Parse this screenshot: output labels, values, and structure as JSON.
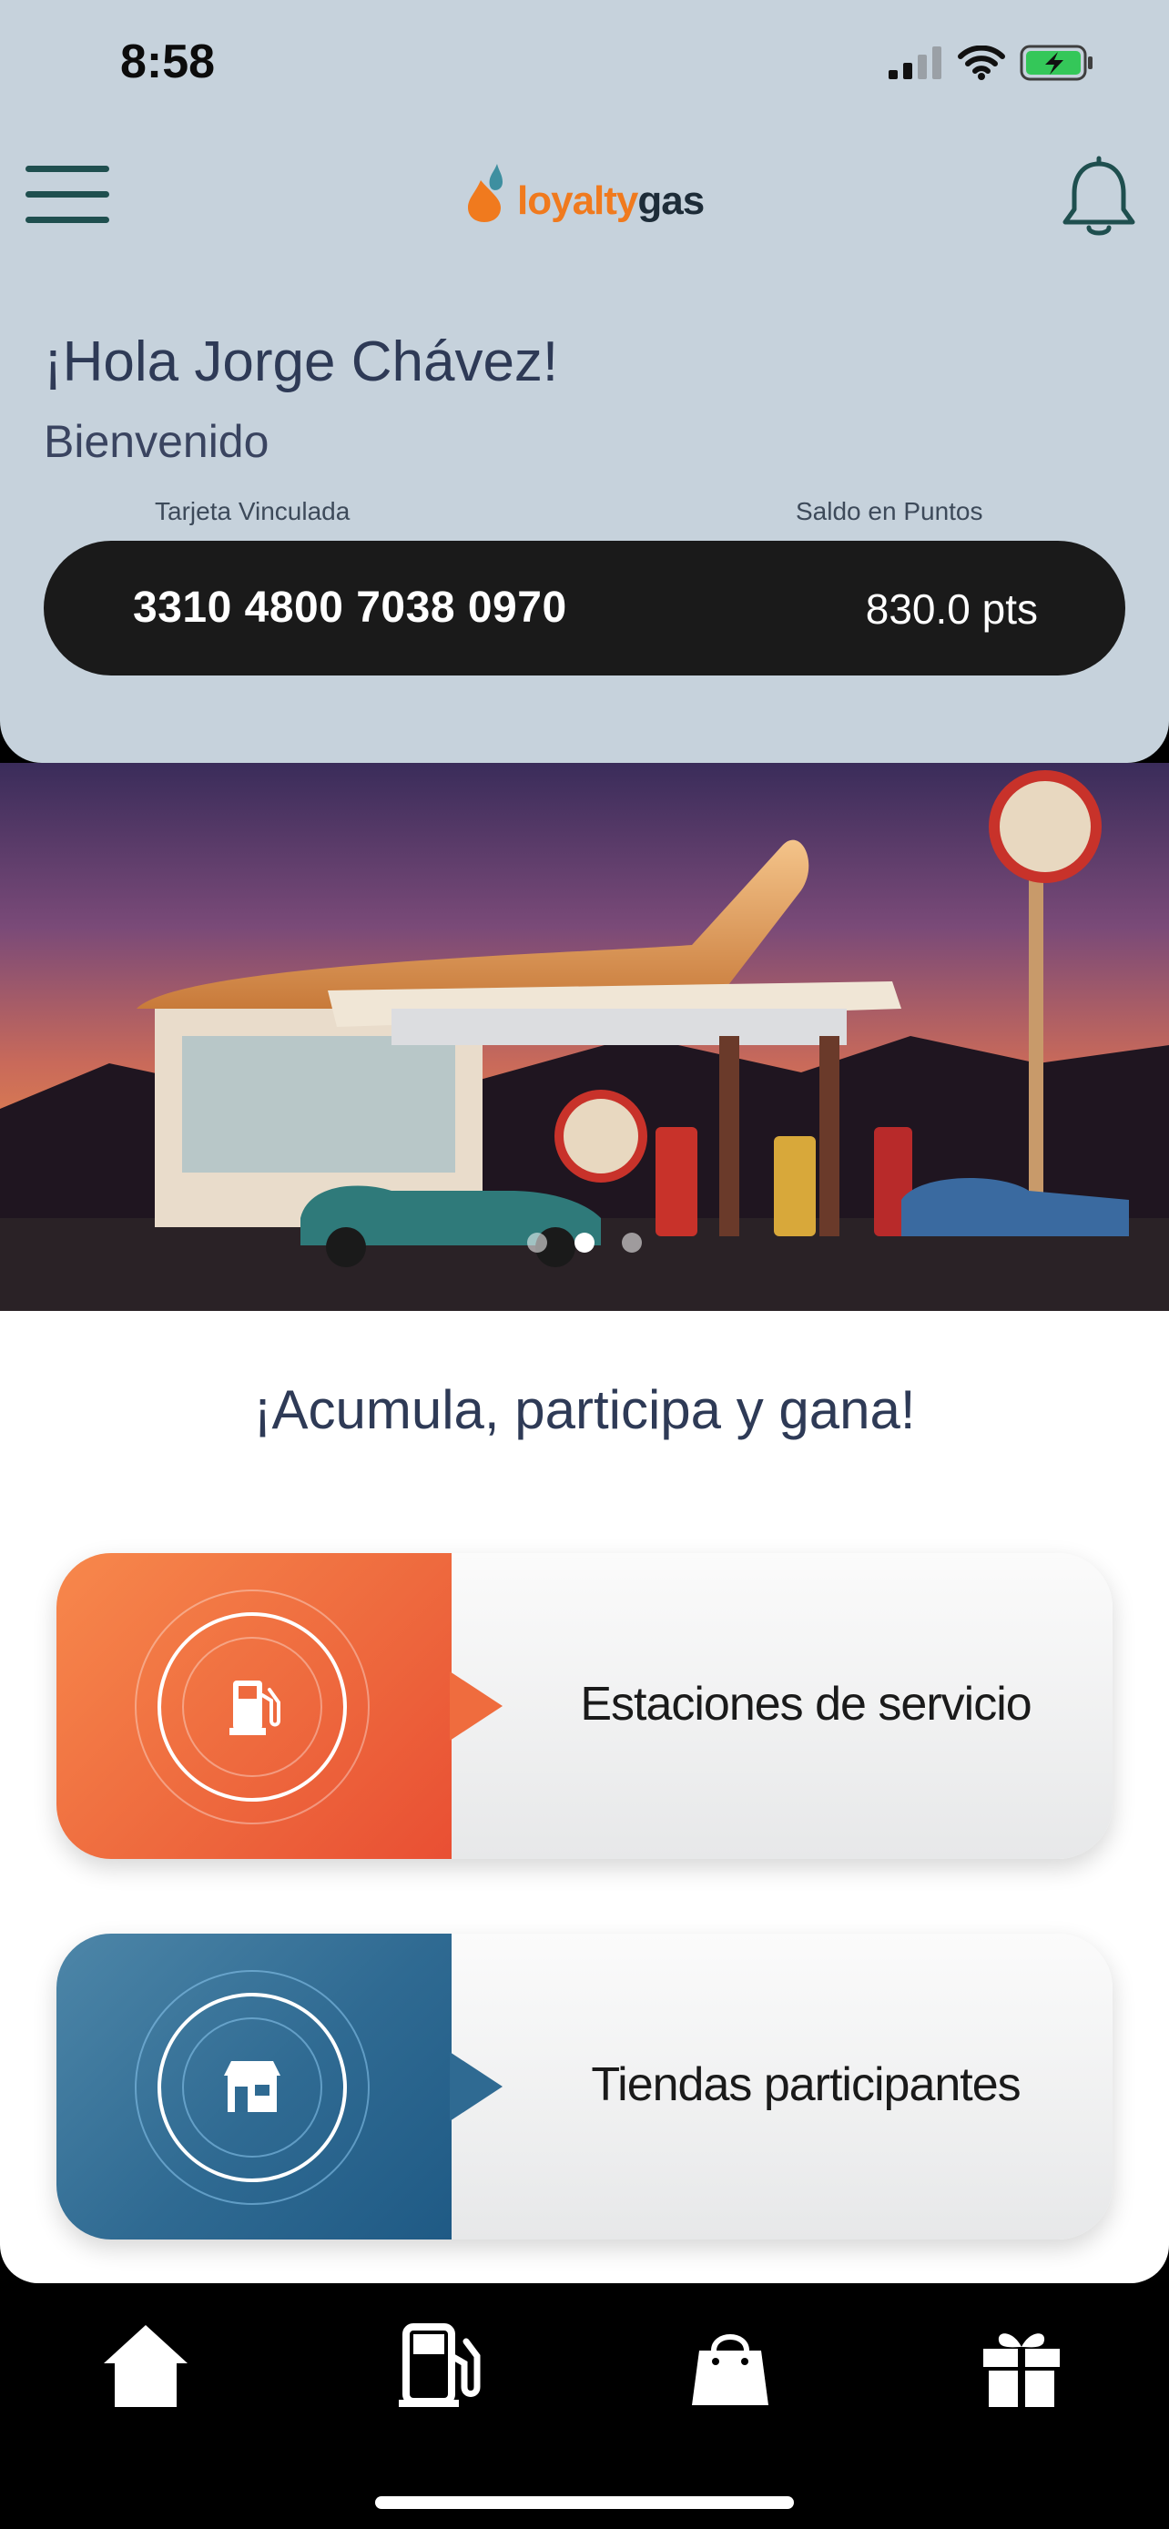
{
  "status_bar": {
    "time": "8:58"
  },
  "header": {
    "logo": {
      "part1": "loyalty",
      "part2": "gas"
    },
    "greeting": "¡Hola Jorge Chávez!",
    "welcome": "Bienvenido",
    "card_label": "Tarjeta Vinculada",
    "points_label": "Saldo en Puntos",
    "card_number": "3310 4800 7038 0970",
    "points": "830.0 pts"
  },
  "banner": {
    "current_slide": 2,
    "slide_count": 3
  },
  "main": {
    "tagline": "¡Acumula, participa y gana!",
    "actions": [
      {
        "label": "Estaciones de servicio",
        "icon": "fuel-pump-icon",
        "color": "#ee6a3e"
      },
      {
        "label": "Tiendas participantes",
        "icon": "store-icon",
        "color": "#2f6a92"
      }
    ]
  },
  "bottom_nav": {
    "items": [
      {
        "icon": "home-icon",
        "active": true
      },
      {
        "icon": "fuel-pump-icon"
      },
      {
        "icon": "shopping-bag-icon"
      },
      {
        "icon": "gift-icon"
      }
    ]
  },
  "colors": {
    "header_bg": "#c6d2dc",
    "brand_orange": "#f07a1e",
    "text_dark": "#2e3a56"
  }
}
